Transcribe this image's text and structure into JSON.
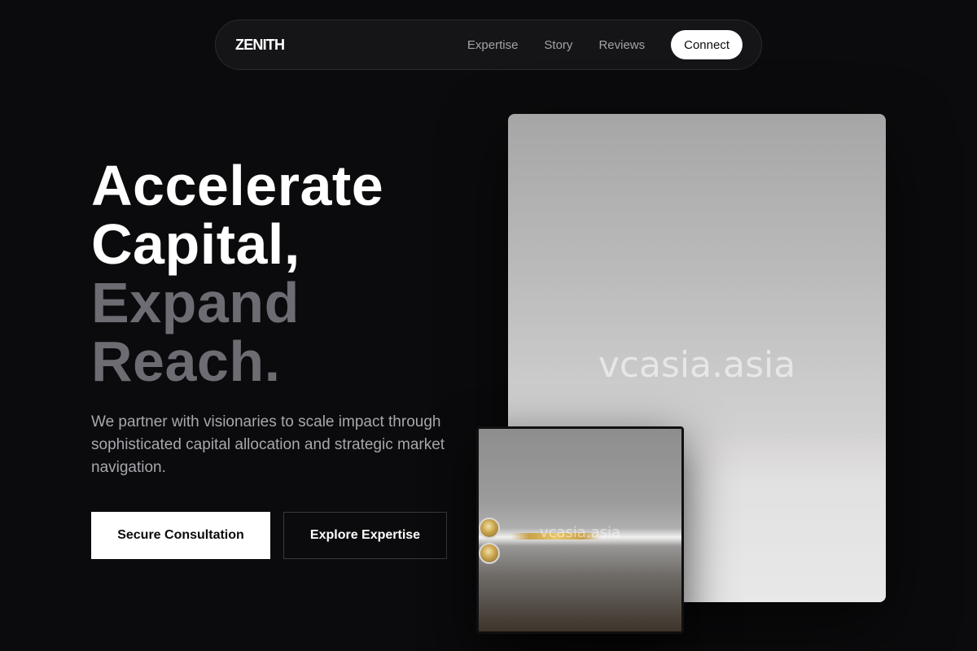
{
  "nav": {
    "logo": "ZENITH",
    "links": [
      "Expertise",
      "Story",
      "Reviews"
    ],
    "cta": "Connect"
  },
  "hero": {
    "headline_white": [
      "Accelerate",
      "Capital,"
    ],
    "headline_gray": [
      "Expand",
      "Reach."
    ],
    "subtitle": "We partner with visionaries to scale impact through sophisticated capital allocation and strategic market navigation.",
    "primary_button": "Secure Consultation",
    "secondary_button": "Explore Expertise"
  },
  "images": {
    "large_watermark": "vcasia.asia",
    "small_watermark": "vcasia.asia"
  },
  "colors": {
    "background": "#0b0b0d",
    "nav_bg": "#151518",
    "headline_gray": "#6d6c72",
    "subtitle": "#a7a7ad",
    "accent": "#ffffff"
  }
}
